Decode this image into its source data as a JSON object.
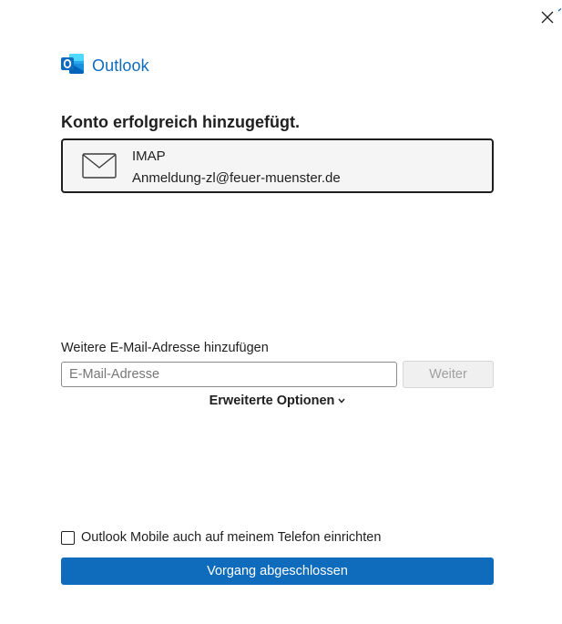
{
  "app": {
    "name": "Outlook",
    "brand_color": "#0f6cbd"
  },
  "window": {
    "close_icon": "close-icon"
  },
  "success": {
    "heading": "Konto erfolgreich hinzugefügt."
  },
  "account": {
    "icon": "envelope-icon",
    "type": "IMAP",
    "email": "Anmeldung-zl@feuer-muenster.de"
  },
  "add_email": {
    "label": "Weitere E-Mail-Adresse hinzufügen",
    "value": "",
    "placeholder": "E-Mail-Adresse",
    "next_label": "Weiter"
  },
  "advanced": {
    "label": "Erweiterte Optionen",
    "icon": "chevron-down-icon"
  },
  "mobile": {
    "label": "Outlook Mobile auch auf meinem Telefon einrichten",
    "checked": false
  },
  "done": {
    "label": "Vorgang abgeschlossen",
    "color": "#0f6cbd"
  }
}
